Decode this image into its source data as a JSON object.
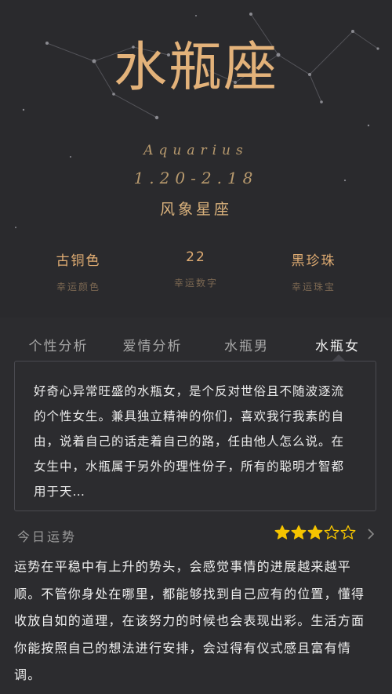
{
  "sign": {
    "name": "水瓶座",
    "latin": "Aquarius",
    "dates": "1.20-2.18",
    "element": "风象星座"
  },
  "lucky": [
    {
      "value": "古铜色",
      "label": "幸运颜色"
    },
    {
      "value": "22",
      "label": "幸运数字"
    },
    {
      "value": "黑珍珠",
      "label": "幸运珠宝"
    }
  ],
  "tabs": [
    {
      "label": "个性分析",
      "active": false
    },
    {
      "label": "爱情分析",
      "active": false
    },
    {
      "label": "水瓶男",
      "active": false
    },
    {
      "label": "水瓶女",
      "active": true
    }
  ],
  "description": "好奇心异常旺盛的水瓶女，是个反对世俗且不随波逐流的个性女生。兼具独立精神的你们，喜欢我行我素的自由，说着自己的话走着自己的路，任由他人怎么说。在女生中，水瓶属于另外的理性份子，所有的聪明才智都用于天…",
  "fortune": {
    "label": "今日运势",
    "rating": 3,
    "rating_max": 5,
    "text": "运势在平稳中有上升的势头，会感觉事情的进展越来越平顺。不管你身处在哪里，都能够找到自己应有的位置，懂得收放自如的道理，在该努力的时候也会表现出彩。生活方面你能按照自己的想法进行安排，会过得有仪式感且富有情调。"
  },
  "colors": {
    "accent": "#e3b27a",
    "star_fill": "#f5c400",
    "background": "#2c2c2f"
  },
  "icons": {
    "rating_star": "star-icon",
    "more": "chevron-right-icon"
  }
}
